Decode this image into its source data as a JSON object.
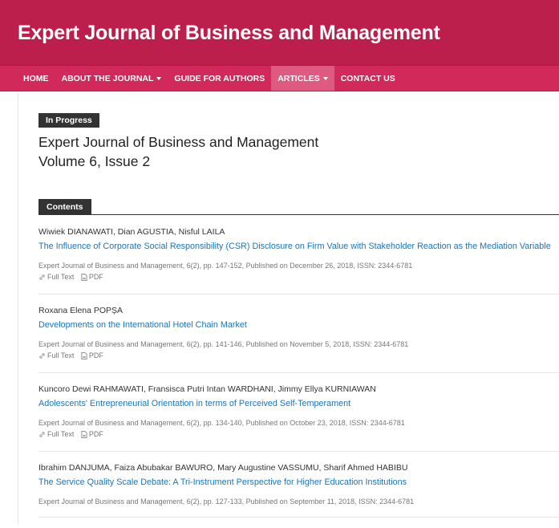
{
  "site": {
    "title": "Expert Journal of Business and Management"
  },
  "nav": {
    "items": [
      {
        "label": "HOME"
      },
      {
        "label": "ABOUT THE JOURNAL"
      },
      {
        "label": "GUIDE FOR AUTHORS"
      },
      {
        "label": "ARTICLES"
      },
      {
        "label": "CONTACT US"
      }
    ]
  },
  "issue": {
    "badge": "In Progress",
    "journal": "Expert Journal of Business and Management",
    "volume": "Volume 6, Issue 2"
  },
  "toc": {
    "label": "Contents"
  },
  "links": {
    "fulltext": "Full Text",
    "pdf": "PDF"
  },
  "articles": [
    {
      "authors": "Wiwiek DIANAWATI, Dian AGUSTIA, Nisful LAILA",
      "title": "The Influence of Corporate Social Responsibility (CSR) Disclosure on Firm Value with Stakeholder Reaction as the Mediation Variable",
      "meta": "Expert Journal of Business and Management, 6(2), pp. 147-152, Published on December 26, 2018, ISSN: 2344-6781"
    },
    {
      "authors": "Roxana Elena POPȘA",
      "title": "Developments on the International Hotel Chain Market",
      "meta": "Expert Journal of Business and Management, 6(2), pp. 141-146, Published on November 5, 2018, ISSN: 2344-6781"
    },
    {
      "authors": "Kuncoro Dewi RAHMAWATI, Fransisca Putri Intan WARDHANI, Jimmy Ellya KURNIAWAN",
      "title": "Adolescents' Entrepreneurial Orientation in terms of Perceived Self-Temperament",
      "meta": "Expert Journal of Business and Management, 6(2), pp. 134-140, Published on October 23, 2018, ISSN: 2344-6781"
    },
    {
      "authors": "Ibrahim DANJUMA, Faiza Abubakar BAWURO, Mary Augustine VASSUMU, Sharif Ahmed HABIBU",
      "title": "The Service Quality Scale Debate: A Tri-Instrument Perspective for Higher Education Institutions",
      "meta": "Expert Journal of Business and Management, 6(2), pp. 127-133, Published on September 11, 2018, ISSN: 2344-6781"
    }
  ]
}
